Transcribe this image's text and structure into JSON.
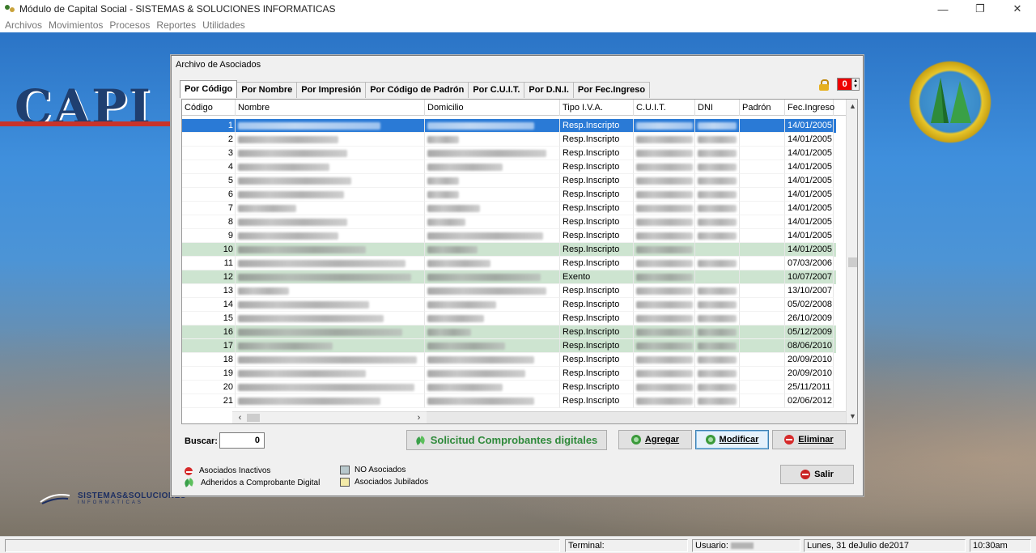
{
  "window": {
    "title": "Módulo de Capital Social - SISTEMAS & SOLUCIONES INFORMATICAS",
    "controls": [
      "—",
      "❐",
      "✕"
    ]
  },
  "menu": [
    "Archivos",
    "Movimientos",
    "Procesos",
    "Reportes",
    "Utilidades"
  ],
  "background": {
    "brand_text": "CAPI",
    "footer_brand": "SISTEMAS&SOLUCIONES",
    "footer_sub": "INFORMATICAS"
  },
  "dialog": {
    "title": "Archivo de Asociados",
    "tabs": [
      "Por Código",
      "Por Nombre",
      "Por Impresión",
      "Por Código de Padrón",
      "Por C.U.I.T.",
      "Por D.N.I.",
      "Por Fec.Ingreso"
    ],
    "counter_value": "0",
    "columns": [
      "Código",
      "Nombre",
      "Domicilio",
      "Tipo I.V.A.",
      "C.U.I.T.",
      "DNI",
      "Padrón",
      "Fec.Ingreso"
    ],
    "rows": [
      {
        "codigo": "1",
        "iva": "Resp.Inscripto",
        "fecha": "14/01/2005",
        "state": "selected"
      },
      {
        "codigo": "2",
        "iva": "Resp.Inscripto",
        "fecha": "14/01/2005",
        "state": "normal"
      },
      {
        "codigo": "3",
        "iva": "Resp.Inscripto",
        "fecha": "14/01/2005",
        "state": "normal"
      },
      {
        "codigo": "4",
        "iva": "Resp.Inscripto",
        "fecha": "14/01/2005",
        "state": "normal"
      },
      {
        "codigo": "5",
        "iva": "Resp.Inscripto",
        "fecha": "14/01/2005",
        "state": "normal"
      },
      {
        "codigo": "6",
        "iva": "Resp.Inscripto",
        "fecha": "14/01/2005",
        "state": "normal"
      },
      {
        "codigo": "7",
        "iva": "Resp.Inscripto",
        "fecha": "14/01/2005",
        "state": "normal"
      },
      {
        "codigo": "8",
        "iva": "Resp.Inscripto",
        "fecha": "14/01/2005",
        "state": "normal"
      },
      {
        "codigo": "9",
        "iva": "Resp.Inscripto",
        "fecha": "14/01/2005",
        "state": "normal"
      },
      {
        "codigo": "10",
        "iva": "Resp.Inscripto",
        "fecha": "14/01/2005",
        "state": "green"
      },
      {
        "codigo": "11",
        "iva": "Resp.Inscripto",
        "fecha": "07/03/2006",
        "state": "normal"
      },
      {
        "codigo": "12",
        "iva": "Exento",
        "fecha": "10/07/2007",
        "state": "green"
      },
      {
        "codigo": "13",
        "iva": "Resp.Inscripto",
        "fecha": "13/10/2007",
        "state": "normal"
      },
      {
        "codigo": "14",
        "iva": "Resp.Inscripto",
        "fecha": "05/02/2008",
        "state": "normal"
      },
      {
        "codigo": "15",
        "iva": "Resp.Inscripto",
        "fecha": "26/10/2009",
        "state": "normal"
      },
      {
        "codigo": "16",
        "iva": "Resp.Inscripto",
        "fecha": "05/12/2009",
        "state": "green"
      },
      {
        "codigo": "17",
        "iva": "Resp.Inscripto",
        "fecha": "08/06/2010",
        "state": "green"
      },
      {
        "codigo": "18",
        "iva": "Resp.Inscripto",
        "fecha": "20/09/2010",
        "state": "normal"
      },
      {
        "codigo": "19",
        "iva": "Resp.Inscripto",
        "fecha": "20/09/2010",
        "state": "normal"
      },
      {
        "codigo": "20",
        "iva": "Resp.Inscripto",
        "fecha": "25/11/2011",
        "state": "normal"
      },
      {
        "codigo": "21",
        "iva": "Resp.Inscripto",
        "fecha": "02/06/2012",
        "state": "normal"
      }
    ],
    "buscar_label": "Buscar:",
    "buscar_value": "0",
    "buttons": {
      "solicitud": "Solicitud Comprobantes digitales",
      "agregar": "Agregar",
      "modificar": "Modificar",
      "eliminar": "Eliminar",
      "salir": "Salir"
    },
    "legend": {
      "inactivos": "Asociados Inactivos",
      "adheridos": "Adheridos a Comprobante Digital",
      "no_asociados": "NO Asociados",
      "jubilados": "Asociados Jubilados"
    }
  },
  "statusbar": {
    "terminal": "Terminal:",
    "usuario": "Usuario:",
    "fecha": "Lunes, 31 deJulio de2017",
    "hora": "10:30am"
  },
  "colors": {
    "selected_row": "#2a7ad6",
    "green_row": "#cde4d0",
    "counter_bg": "#e00000",
    "solicitud_text": "#2f8a3b",
    "no_asociados_swatch": "#b8c8cc",
    "jubilados_swatch": "#f3eaa8"
  }
}
